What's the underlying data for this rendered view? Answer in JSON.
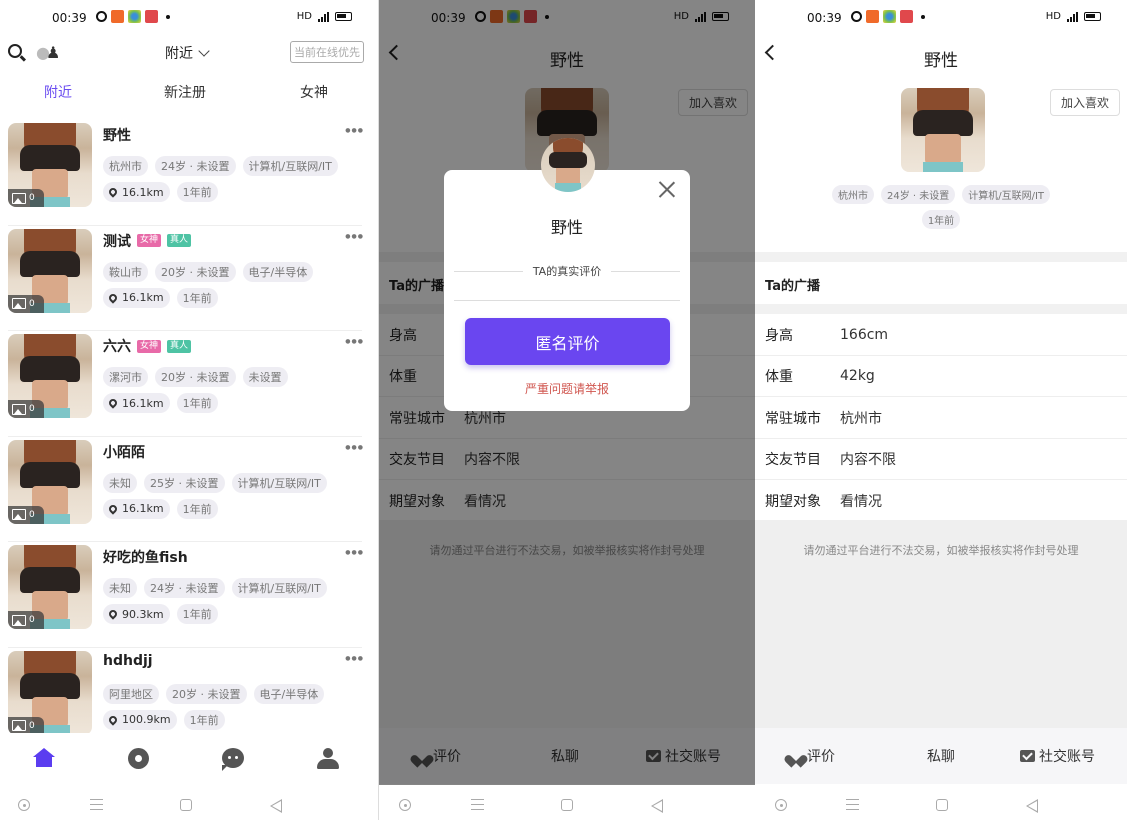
{
  "status_bar": {
    "time": "00:39",
    "network": "HD",
    "signal": "4G"
  },
  "list_screen": {
    "header": {
      "location_filter": "附近",
      "online_button": "当前在线优先"
    },
    "tabs": [
      {
        "label": "附近",
        "active": true
      },
      {
        "label": "新注册",
        "active": false
      },
      {
        "label": "女神",
        "active": false
      }
    ],
    "users": [
      {
        "name": "野性",
        "badges": [],
        "photo_count": "0",
        "city": "杭州市",
        "age": "24岁 · 未设置",
        "job": "计算机/互联网/IT",
        "distance": "16.1km",
        "time": "1年前"
      },
      {
        "name": "测试",
        "badges": [
          "女神",
          "真人"
        ],
        "photo_count": "0",
        "city": "鞍山市",
        "age": "20岁 · 未设置",
        "job": "电子/半导体",
        "distance": "16.1km",
        "time": "1年前"
      },
      {
        "name": "六六",
        "badges": [
          "女神",
          "真人"
        ],
        "photo_count": "0",
        "city": "漯河市",
        "age": "20岁 · 未设置",
        "job": "未设置",
        "distance": "16.1km",
        "time": "1年前"
      },
      {
        "name": "小陌陌",
        "badges": [],
        "photo_count": "0",
        "city": "未知",
        "age": "25岁 · 未设置",
        "job": "计算机/互联网/IT",
        "distance": "16.1km",
        "time": "1年前"
      },
      {
        "name": "好吃的鱼fish",
        "badges": [],
        "photo_count": "0",
        "city": "未知",
        "age": "24岁 · 未设置",
        "job": "计算机/互联网/IT",
        "distance": "90.3km",
        "time": "1年前"
      },
      {
        "name": "hdhdjj",
        "badges": [],
        "photo_count": "0",
        "city": "阿里地区",
        "age": "20岁 · 未设置",
        "job": "电子/半导体",
        "distance": "100.9km",
        "time": "1年前"
      }
    ],
    "bottom_nav": [
      "home",
      "discover",
      "messages",
      "profile"
    ]
  },
  "detail": {
    "title": "野性",
    "favorite_button": "加入喜欢",
    "tags": [
      "杭州市",
      "24岁 · 未设置",
      "计算机/互联网/IT",
      "1年前"
    ],
    "broadcast_label": "Ta的广播",
    "info": [
      {
        "key": "身高",
        "value": "166cm"
      },
      {
        "key": "体重",
        "value": "42kg"
      },
      {
        "key": "常驻城市",
        "value": "杭州市"
      },
      {
        "key": "交友节目",
        "value": "内容不限"
      },
      {
        "key": "期望对象",
        "value": "看情况"
      }
    ],
    "notice": "请勿通过平台进行不法交易，如被举报核实将作封号处理",
    "actions": {
      "review": "评价",
      "chat": "私聊",
      "social": "社交账号"
    }
  },
  "modal": {
    "name": "野性",
    "subtitle": "TA的真实评价",
    "anon_button": "匿名评价",
    "report_link": "严重问题请举报"
  },
  "colors": {
    "accent": "#6a46f0",
    "goddess_badge": "#e86aa8",
    "real_badge": "#4ec3a4",
    "report": "#d0564f"
  }
}
